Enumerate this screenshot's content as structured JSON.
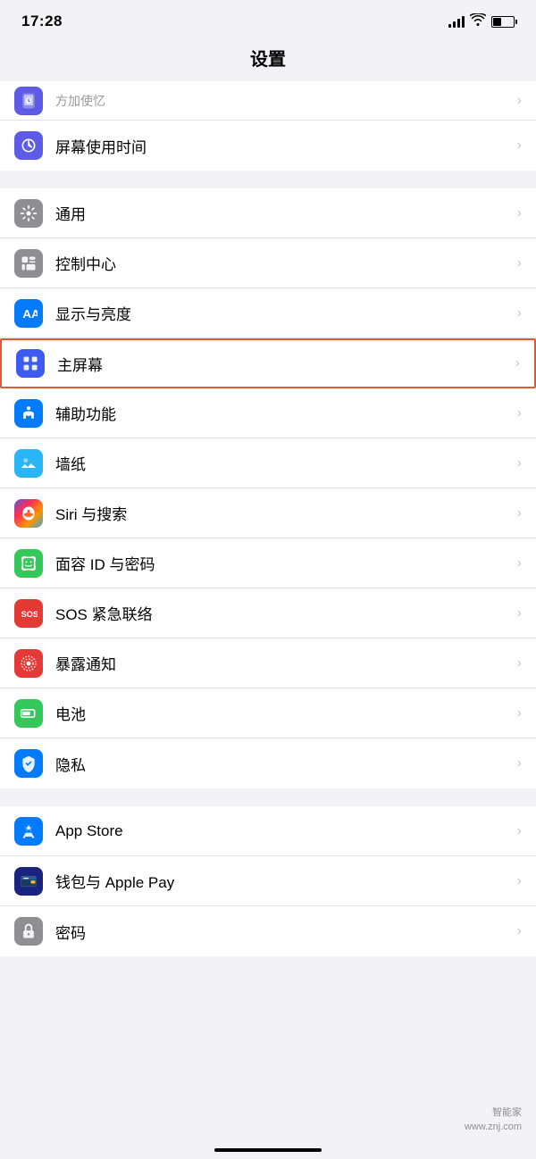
{
  "statusBar": {
    "time": "17:28",
    "locationArrow": "▶",
    "battery": "40"
  },
  "pageTitle": "设置",
  "sections": [
    {
      "id": "section1",
      "items": [
        {
          "id": "screentime",
          "icon": "screentime",
          "label": "屏幕使用时间",
          "iconColor": "#5e5ce6",
          "highlighted": false,
          "partial": true
        },
        {
          "id": "screentime2",
          "icon": "screentime",
          "label": "屏幕使用时间",
          "iconColor": "#5e5ce6",
          "highlighted": false,
          "partial": false,
          "topCropped": true
        }
      ]
    },
    {
      "id": "section2",
      "items": [
        {
          "id": "general",
          "icon": "general",
          "label": "通用",
          "iconColor": "#8e8e93",
          "highlighted": false
        },
        {
          "id": "control",
          "icon": "control",
          "label": "控制中心",
          "iconColor": "#8e8e93",
          "highlighted": false
        },
        {
          "id": "display",
          "icon": "display",
          "label": "显示与亮度",
          "iconColor": "#007aff",
          "highlighted": false
        },
        {
          "id": "home",
          "icon": "home",
          "label": "主屏幕",
          "iconColor": "#3d5af1",
          "highlighted": true
        },
        {
          "id": "accessibility",
          "icon": "accessibility",
          "label": "辅助功能",
          "iconColor": "#007aff",
          "highlighted": false
        },
        {
          "id": "wallpaper",
          "icon": "wallpaper",
          "label": "墙纸",
          "iconColor": "#29b6f6",
          "highlighted": false
        },
        {
          "id": "siri",
          "icon": "siri",
          "label": "Siri 与搜索",
          "iconColor": "#000",
          "highlighted": false
        },
        {
          "id": "faceid",
          "icon": "faceid",
          "label": "面容 ID 与密码",
          "iconColor": "#34c759",
          "highlighted": false
        },
        {
          "id": "sos",
          "icon": "sos",
          "label": "SOS 紧急联络",
          "iconColor": "#e53935",
          "highlighted": false
        },
        {
          "id": "exposure",
          "icon": "exposure",
          "label": "暴露通知",
          "iconColor": "#e53935",
          "highlighted": false
        },
        {
          "id": "battery",
          "icon": "battery",
          "label": "电池",
          "iconColor": "#34c759",
          "highlighted": false
        },
        {
          "id": "privacy",
          "icon": "privacy",
          "label": "隐私",
          "iconColor": "#007aff",
          "highlighted": false
        }
      ]
    },
    {
      "id": "section3",
      "items": [
        {
          "id": "appstore",
          "icon": "appstore",
          "label": "App Store",
          "iconColor": "#007aff",
          "highlighted": false
        },
        {
          "id": "wallet",
          "icon": "wallet",
          "label": "钱包与 Apple Pay",
          "iconColor": "#1a237e",
          "highlighted": false
        },
        {
          "id": "password",
          "icon": "password",
          "label": "密码",
          "iconColor": "#8e8e93",
          "highlighted": false,
          "partial": true
        }
      ]
    }
  ],
  "watermark": {
    "line1": "智能家",
    "line2": "www.znj.com"
  }
}
